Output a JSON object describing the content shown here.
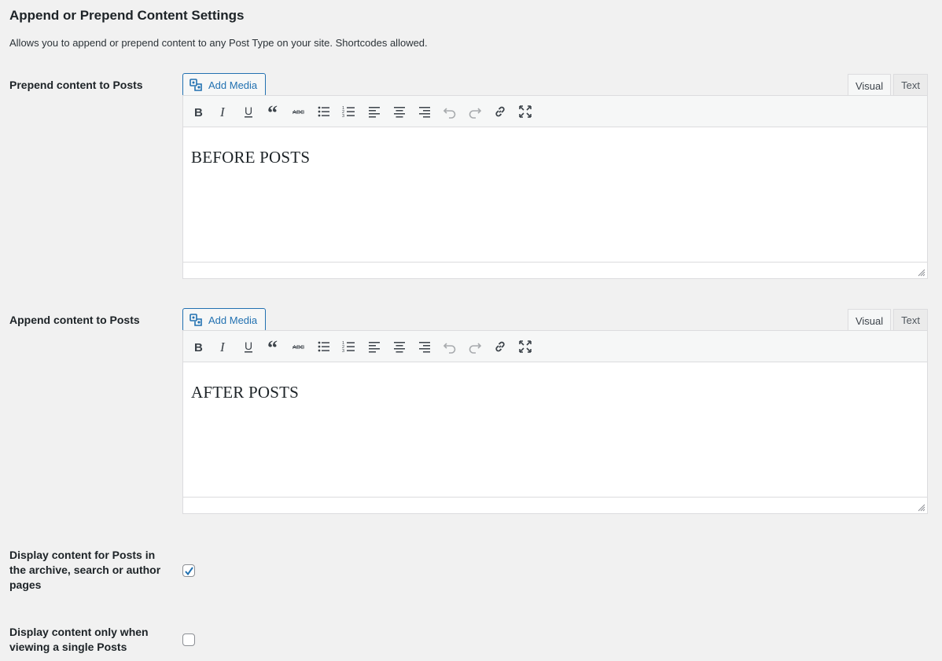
{
  "page": {
    "title": "Append or Prepend Content Settings",
    "description": "Allows you to append or prepend content to any Post Type on your site. Shortcodes allowed."
  },
  "prepend": {
    "label": "Prepend content to Posts",
    "add_media_label": "Add Media",
    "tab_visual": "Visual",
    "tab_text": "Text",
    "content": "BEFORE POSTS"
  },
  "append": {
    "label": "Append content to Posts",
    "add_media_label": "Add Media",
    "tab_visual": "Visual",
    "tab_text": "Text",
    "content": "AFTER POSTS"
  },
  "toolbar_icons": [
    "bold-icon",
    "italic-icon",
    "underline-icon",
    "blockquote-icon",
    "strikethrough-icon",
    "bulleted-list-icon",
    "numbered-list-icon",
    "align-left-icon",
    "align-center-icon",
    "align-right-icon",
    "undo-icon",
    "redo-icon",
    "link-icon",
    "fullscreen-icon"
  ],
  "option_archive": {
    "label": "Display content for Posts in the archive, search or author pages",
    "checked": true
  },
  "option_single": {
    "label": "Display content only when viewing a single Posts",
    "checked": false
  },
  "colors": {
    "accent": "#2271b1",
    "background": "#f1f1f1",
    "text": "#1d2327"
  }
}
